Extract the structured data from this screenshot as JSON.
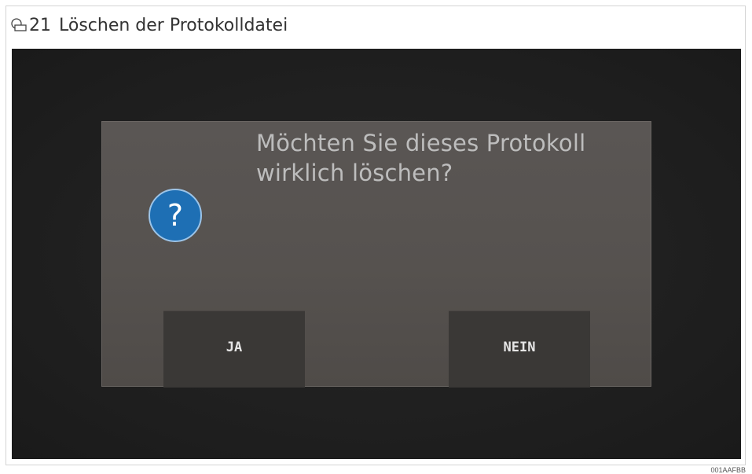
{
  "figure": {
    "number": "21",
    "title": "Löschen der Protokolldatei",
    "icon": "figure-icon"
  },
  "dialog": {
    "icon": "question-icon",
    "icon_glyph": "?",
    "icon_color": "#1e6fb4",
    "message": "Möchten Sie dieses Protokoll wirklich löschen?",
    "confirm_label": "JA",
    "cancel_label": "NEIN"
  },
  "reference_code": "001AAFBB"
}
